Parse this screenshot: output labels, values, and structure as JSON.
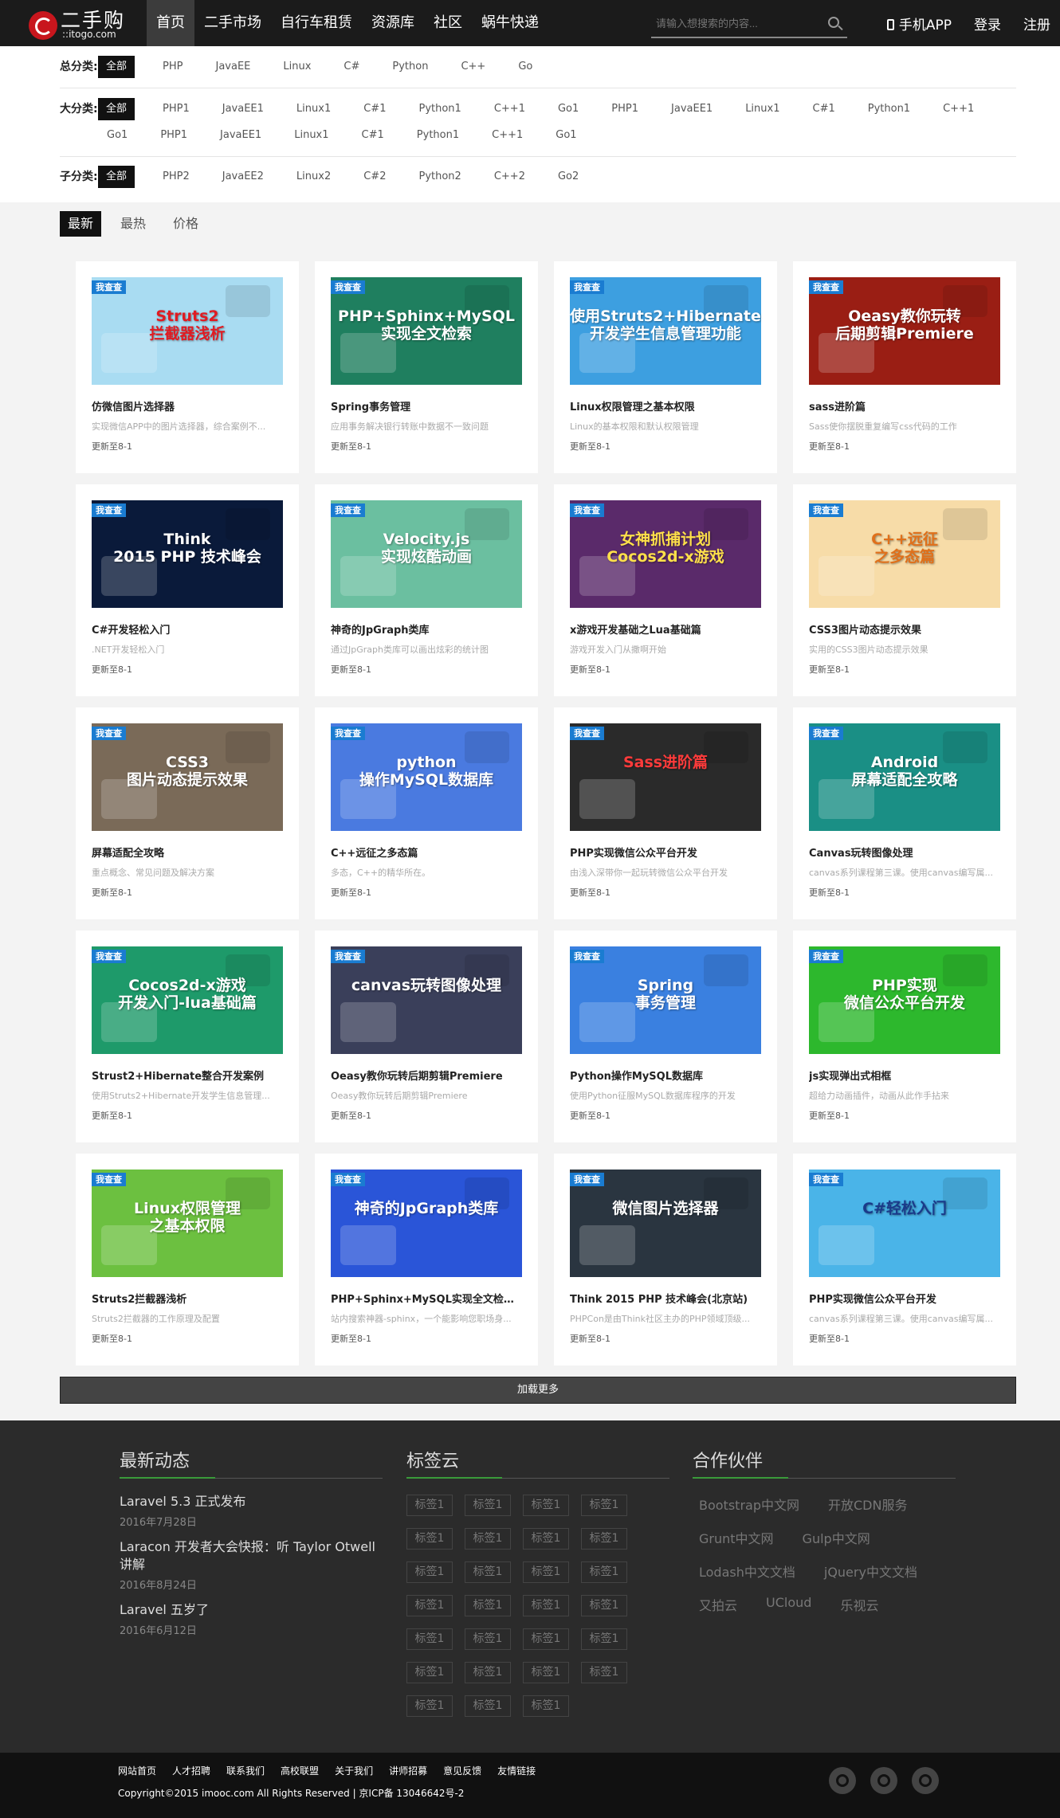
{
  "brand": {
    "name": "二手购",
    "domain": "::itogo.com"
  },
  "nav": [
    {
      "label": "首页",
      "active": true
    },
    {
      "label": "二手市场"
    },
    {
      "label": "自行车租赁"
    },
    {
      "label": "资源库"
    },
    {
      "label": "社区"
    },
    {
      "label": "蜗牛快递"
    }
  ],
  "search": {
    "placeholder": "请输入想搜索的内容..."
  },
  "header_links": {
    "app": "手机APP",
    "login": "登录",
    "register": "注册"
  },
  "filters": {
    "total": {
      "label": "总分类:",
      "tags": [
        "全部",
        "PHP",
        "JavaEE",
        "Linux",
        "C#",
        "Python",
        "C++",
        "Go"
      ]
    },
    "major": {
      "label": "大分类:",
      "tags": [
        "全部",
        "PHP1",
        "JavaEE1",
        "Linux1",
        "C#1",
        "Python1",
        "C++1",
        "Go1",
        "PHP1",
        "JavaEE1",
        "Linux1",
        "C#1",
        "Python1",
        "C++1",
        "Go1",
        "PHP1",
        "JavaEE1",
        "Linux1",
        "C#1",
        "Python1",
        "C++1",
        "Go1"
      ]
    },
    "sub": {
      "label": "子分类:",
      "tags": [
        "全部",
        "PHP2",
        "JavaEE2",
        "Linux2",
        "C#2",
        "Python2",
        "C++2",
        "Go2"
      ]
    }
  },
  "sorts": [
    "最新",
    "最热",
    "价格"
  ],
  "badge": "我查查",
  "cards": [
    {
      "title": "仿微信图片选择器",
      "desc": "实现微信APP中的图片选择器，综合案例不...",
      "update": "更新至8-1",
      "cap": "Struts2\n拦截器浅析",
      "bg": "#a9dcf2",
      "fg": "#e01b22"
    },
    {
      "title": "Spring事务管理",
      "desc": "应用事务解决银行转账中数据不一致问题",
      "update": "更新至8-1",
      "cap": "PHP+Sphinx+MySQL\n实现全文检索",
      "bg": "#1f7f5f",
      "fg": "#ffffff"
    },
    {
      "title": "Linux权限管理之基本权限",
      "desc": "Linux的基本权限和默认权限管理",
      "update": "更新至8-1",
      "cap": "使用Struts2+Hibernate\n开发学生信息管理功能",
      "bg": "#3d9fe0",
      "fg": "#ffffff"
    },
    {
      "title": "sass进阶篇",
      "desc": "Sass使你摆脱重复编写css代码的工作",
      "update": "更新至8-1",
      "cap": "Oeasy教你玩转\n后期剪辑Premiere",
      "bg": "#9a1e14",
      "fg": "#ffffff"
    },
    {
      "title": "C#开发轻松入门",
      "desc": ".NET开发轻松入门",
      "update": "更新至8-1",
      "cap": "Think\n2015 PHP 技术峰会",
      "bg": "#0a1a3a",
      "fg": "#ffffff"
    },
    {
      "title": "神奇的JpGraph类库",
      "desc": "通过JpGraph类库可以画出炫彩的统计图",
      "update": "更新至8-1",
      "cap": "Velocity.js\n实现炫酷动画",
      "bg": "#6bbfa0",
      "fg": "#ffffff"
    },
    {
      "title": "x游戏开发基础之Lua基础篇",
      "desc": "游戏开发入门从撒啊开始",
      "update": "更新至8-1",
      "cap": "女神抓捕计划\nCocos2d-x游戏",
      "bg": "#5a2a6a",
      "fg": "#ffe04a"
    },
    {
      "title": "CSS3图片动态提示效果",
      "desc": "实用的CSS3图片动态提示效果",
      "update": "更新至8-1",
      "cap": "C++远征\n之多态篇",
      "bg": "#f7dca8",
      "fg": "#e0701a"
    },
    {
      "title": "屏幕适配全攻略",
      "desc": "重点概念、常见问题及解决方案",
      "update": "更新至8-1",
      "cap": "CSS3\n图片动态提示效果",
      "bg": "#7a6a58",
      "fg": "#ffffff"
    },
    {
      "title": "C++远征之多态篇",
      "desc": "多态，C++的精华所在。",
      "update": "更新至8-1",
      "cap": "python\n操作MySQL数据库",
      "bg": "#4a7ae0",
      "fg": "#ffffff"
    },
    {
      "title": "PHP实现微信公众平台开发",
      "desc": "由浅入深带你一起玩转微信公众平台开发",
      "update": "更新至8-1",
      "cap": "Sass进阶篇",
      "bg": "#2a2a2a",
      "fg": "#ff3b3b"
    },
    {
      "title": "Canvas玩转图像处理",
      "desc": "canvas系列课程第三课。使用canvas编写属...",
      "update": "更新至8-1",
      "cap": "Android\n屏幕适配全攻略",
      "bg": "#1a8f85",
      "fg": "#ffffff"
    },
    {
      "title": "Strust2+Hibernate整合开发案例",
      "desc": "使用Struts2+Hibernate开发学生信息管理...",
      "update": "更新至8-1",
      "cap": "Cocos2d-x游戏\n开发入门-lua基础篇",
      "bg": "#1e9a6a",
      "fg": "#ffffff"
    },
    {
      "title": "Oeasy教你玩转后期剪辑Premiere",
      "desc": "Oeasy教你玩转后期剪辑Premiere",
      "update": "更新至8-1",
      "cap": "canvas玩转图像处理",
      "bg": "#3a3f5a",
      "fg": "#ffffff"
    },
    {
      "title": "Python操作MySQL数据库",
      "desc": "使用Python征服MySQL数据库程序的开发",
      "update": "更新至8-1",
      "cap": "Spring\n事务管理",
      "bg": "#3a80e0",
      "fg": "#ffffff"
    },
    {
      "title": "js实现弹出式相框",
      "desc": "超给力动画插件，动画从此作手拈来",
      "update": "更新至8-1",
      "cap": "PHP实现\n微信公众平台开发",
      "bg": "#2db82d",
      "fg": "#ffffff"
    },
    {
      "title": "Struts2拦截器浅析",
      "desc": "Struts2拦截器的工作原理及配置",
      "update": "更新至8-1",
      "cap": "Linux权限管理\n之基本权限",
      "bg": "#6cc040",
      "fg": "#ffffff"
    },
    {
      "title": "PHP+Sphinx+MySQL实现全文检索...",
      "desc": "站内搜索神器-sphinx，一个能影响您职场身...",
      "update": "更新至8-1",
      "cap": "神奇的JpGraph类库",
      "bg": "#2a55d8",
      "fg": "#ffffff"
    },
    {
      "title": "Think 2015 PHP 技术峰会(北京站)",
      "desc": "PHPCon是由Think社区主办的PHP领域顶级...",
      "update": "更新至8-1",
      "cap": "微信图片选择器",
      "bg": "#2a3540",
      "fg": "#ffffff"
    },
    {
      "title": "PHP实现微信公众平台开发",
      "desc": "canvas系列课程第三课。使用canvas编写属...",
      "update": "更新至8-1",
      "cap": "C#轻松入门",
      "bg": "#4ab4e8",
      "fg": "#1a3a8a"
    }
  ],
  "loadmore": "加载更多",
  "footer": {
    "news_title": "最新动态",
    "news": [
      {
        "title": "Laravel 5.3 正式发布",
        "date": "2016年7月28日"
      },
      {
        "title": "Laracon 开发者大会快报：听 Taylor Otwell 讲解",
        "date": "2016年8月24日"
      },
      {
        "title": "Laravel 五岁了",
        "date": "2016年6月12日"
      }
    ],
    "tags_title": "标签云",
    "tags": [
      "标签1",
      "标签1",
      "标签1",
      "标签1",
      "标签1",
      "标签1",
      "标签1",
      "标签1",
      "标签1",
      "标签1",
      "标签1",
      "标签1",
      "标签1",
      "标签1",
      "标签1",
      "标签1",
      "标签1",
      "标签1",
      "标签1",
      "标签1",
      "标签1",
      "标签1",
      "标签1",
      "标签1",
      "标签1",
      "标签1",
      "标签1"
    ],
    "partners_title": "合作伙伴",
    "partners": [
      "Bootstrap中文网",
      "开放CDN服务",
      "Grunt中文网",
      "Gulp中文网",
      "Lodash中文文档",
      "jQuery中文文档",
      "又拍云",
      "UCloud",
      "乐视云"
    ]
  },
  "bottom": {
    "links": [
      "网站首页",
      "人才招聘",
      "联系我们",
      "高校联盟",
      "关于我们",
      "讲师招募",
      "意见反馈",
      "友情链接"
    ],
    "copyright": "Copyright©2015 imooc.com All Rights Reserved | 京ICP备 13046642号-2"
  }
}
